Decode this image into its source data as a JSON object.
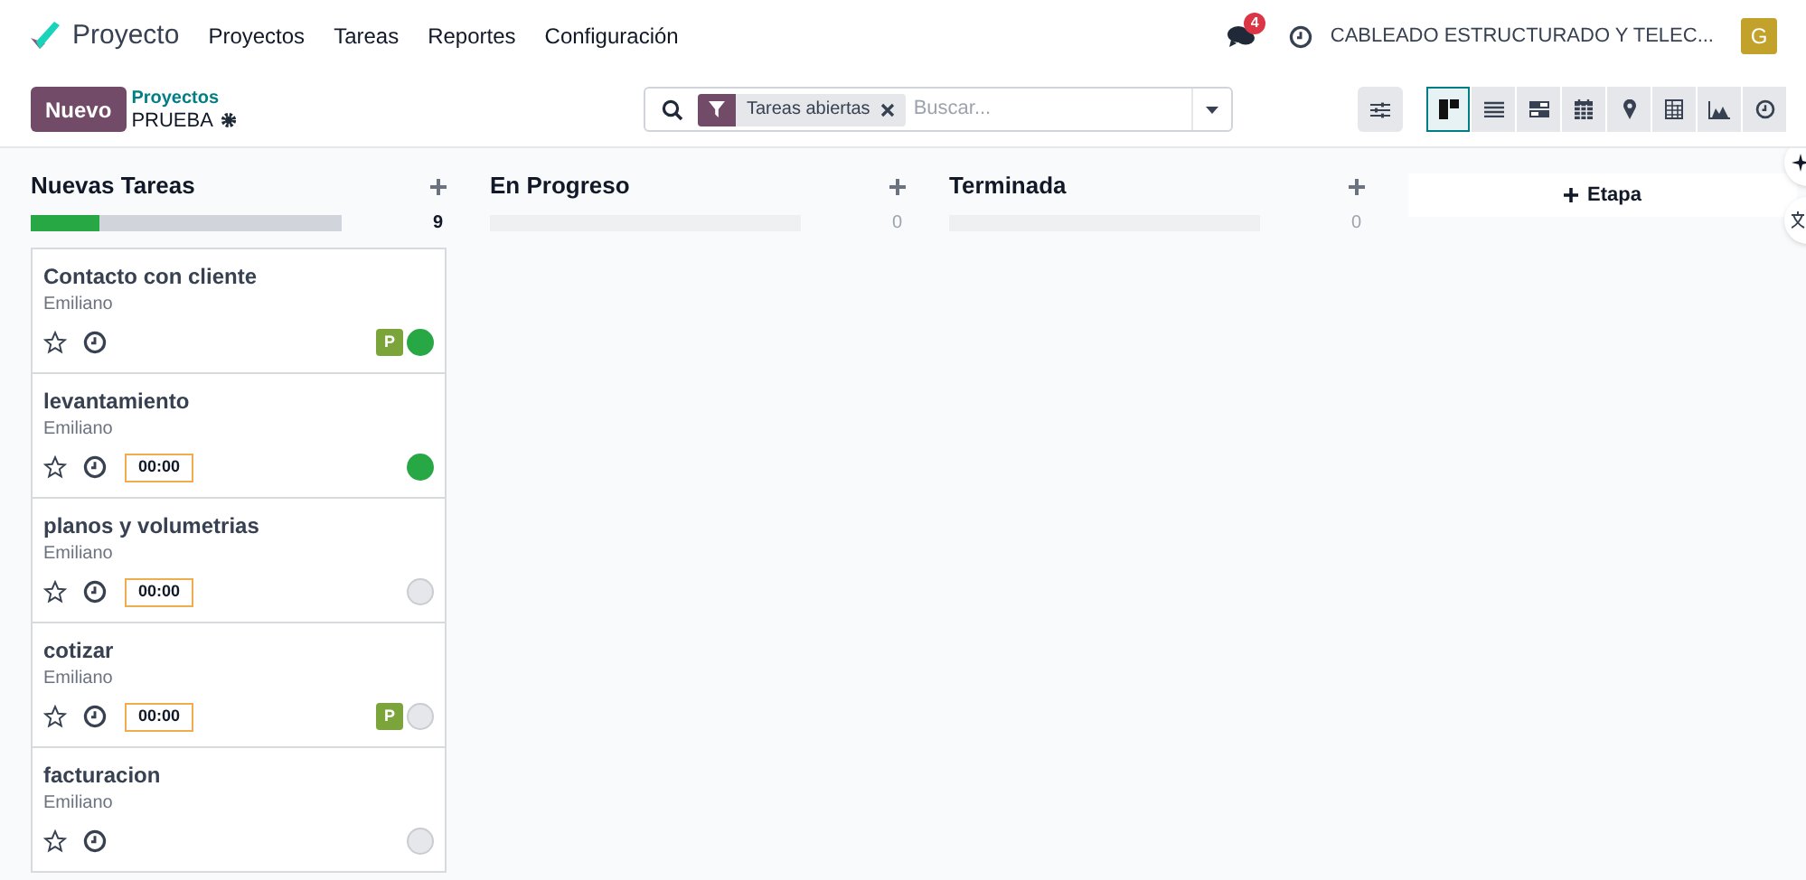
{
  "navbar": {
    "app_name": "Proyecto",
    "menu": [
      "Proyectos",
      "Tareas",
      "Reportes",
      "Configuración"
    ],
    "messages_badge": "4",
    "company": "CABLEADO ESTRUCTURADO Y TELEC...",
    "avatar": "G"
  },
  "control_panel": {
    "new_button": "Nuevo",
    "breadcrumb": "Proyectos",
    "project": "PRUEBA",
    "filter_facet": "Tareas abiertas",
    "search_placeholder": "Buscar...",
    "views": [
      {
        "kind": "kanban",
        "selected": true
      },
      {
        "kind": "list",
        "selected": false
      },
      {
        "kind": "gantt",
        "selected": false
      },
      {
        "kind": "calendar",
        "selected": false
      },
      {
        "kind": "map",
        "selected": false
      },
      {
        "kind": "pivot",
        "selected": false
      },
      {
        "kind": "graph",
        "selected": false
      },
      {
        "kind": "activity",
        "selected": false
      }
    ]
  },
  "columns": [
    {
      "title": "Nuevas Tareas",
      "count": "9",
      "level": 0.22,
      "cards": [
        {
          "title": "Contacto con cliente",
          "assignee": "Emiliano",
          "tag": "P",
          "done": true
        },
        {
          "title": "levantamiento",
          "assignee": "Emiliano",
          "timer": "00:00",
          "done": true
        },
        {
          "title": "planos y volumetrias",
          "assignee": "Emiliano",
          "timer": "00:00",
          "done": false
        },
        {
          "title": "cotizar",
          "assignee": "Emiliano",
          "timer": "00:00",
          "tag": "P",
          "done": false
        },
        {
          "title": "facturacion",
          "assignee": "Emiliano",
          "done": false
        }
      ]
    },
    {
      "title": "En Progreso",
      "count": "0",
      "level": 0
    },
    {
      "title": "Terminada",
      "count": "0",
      "level": 0
    }
  ],
  "add_stage": "Etapa"
}
